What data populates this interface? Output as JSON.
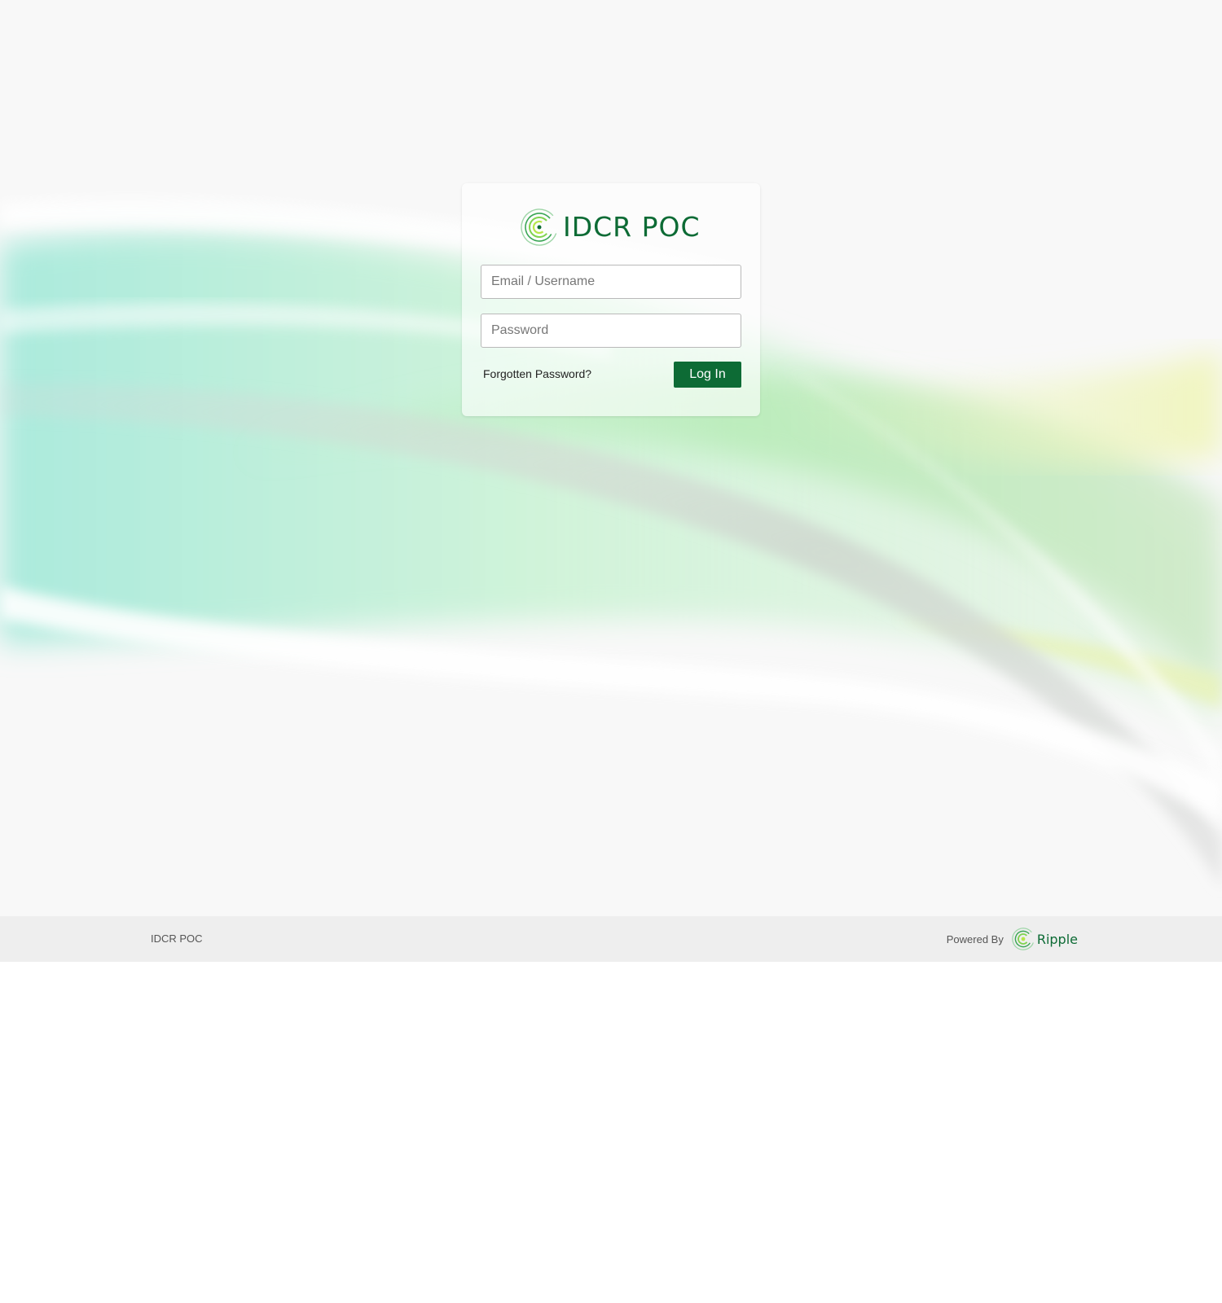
{
  "app": {
    "name": "IDCR POC",
    "logo_icon": "ripple-spiral-icon"
  },
  "login": {
    "email_placeholder": "Email / Username",
    "email_value": "",
    "password_placeholder": "Password",
    "password_value": "",
    "forgot_label": "Forgotten Password?",
    "submit_label": "Log In"
  },
  "footer": {
    "app_name": "IDCR POC",
    "powered_by_label": "Powered By",
    "brand_name": "Ripple",
    "brand_icon": "ripple-spiral-icon"
  },
  "colors": {
    "brand_green": "#0d6b35",
    "accent_light_green": "#7fd34f",
    "footer_background": "#eeeeee",
    "page_background": "#f8f8f8"
  }
}
